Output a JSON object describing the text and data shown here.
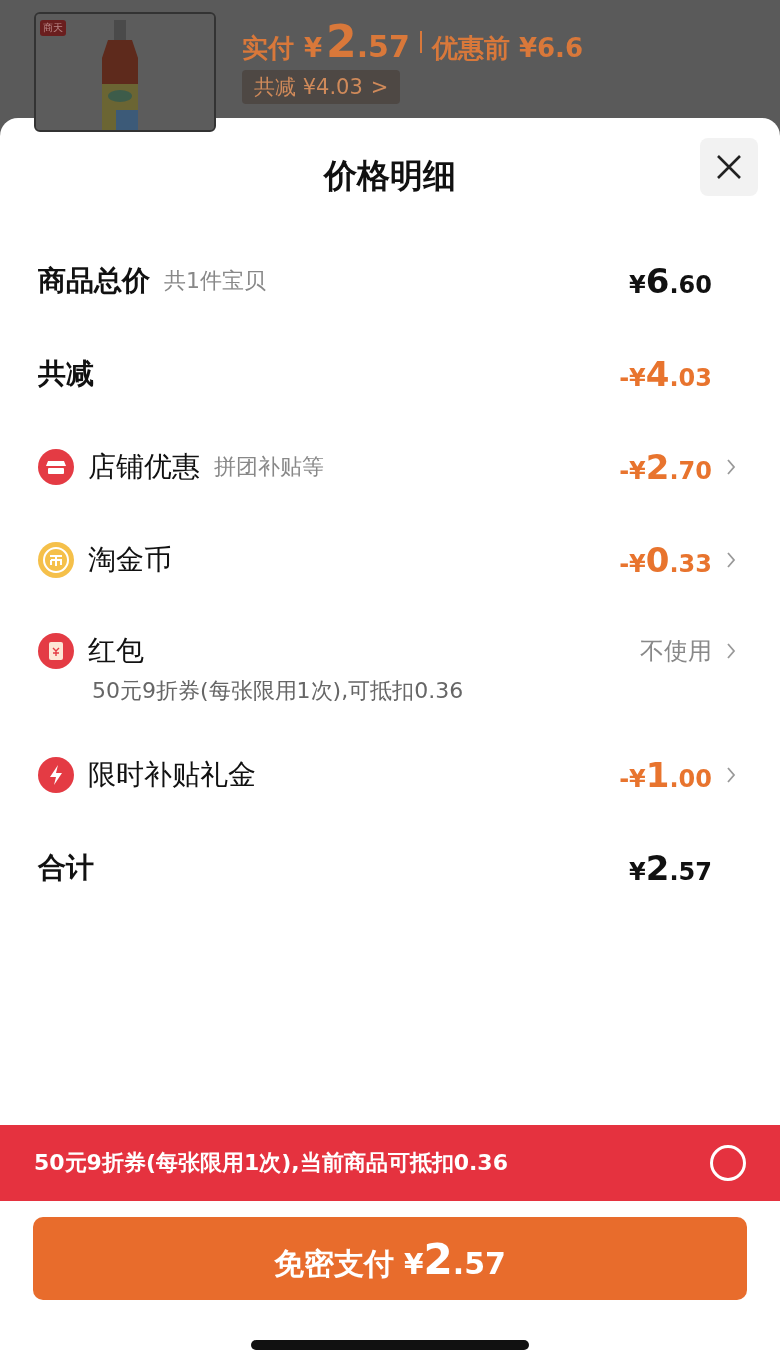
{
  "background": {
    "shop_badge": "商天",
    "paid_label": "实付",
    "paid": {
      "currency": "¥",
      "integer": "2",
      "decimal": ".57"
    },
    "before_label": "优惠前",
    "before": "¥6.6",
    "total_discount": "共减 ¥4.03",
    "total_discount_arrow": ">"
  },
  "sheet": {
    "title": "价格明细",
    "rows": [
      {
        "kind": "total",
        "label": "商品总价",
        "sub": "共1件宝贝",
        "price": {
          "currency": "¥",
          "integer": "6",
          "decimal": ".60"
        }
      },
      {
        "kind": "reduction",
        "label": "共减",
        "price": {
          "currency": "-¥",
          "integer": "4",
          "decimal": ".03"
        }
      },
      {
        "kind": "store",
        "label": "店铺优惠",
        "sub": "拼团补贴等",
        "price": {
          "currency": "-¥",
          "integer": "2",
          "decimal": ".70"
        }
      },
      {
        "kind": "coin",
        "label": "淘金币",
        "price": {
          "currency": "-¥",
          "integer": "0",
          "decimal": ".33"
        }
      },
      {
        "kind": "envelope",
        "label": "红包",
        "value": "不使用",
        "note": "50元9折券(每张限用1次),可抵扣0.36"
      },
      {
        "kind": "flash",
        "label": "限时补贴礼金",
        "price": {
          "currency": "-¥",
          "integer": "1",
          "decimal": ".00"
        }
      },
      {
        "kind": "total",
        "label": "合计",
        "price": {
          "currency": "¥",
          "integer": "2",
          "decimal": ".57"
        }
      }
    ],
    "coupon_bar": {
      "text": "50元9折券(每张限用1次),当前商品可抵扣0.36",
      "selected": false
    },
    "pay_button": {
      "label": "免密支付",
      "price": {
        "currency": "¥",
        "integer": "2",
        "decimal": ".57"
      }
    }
  }
}
